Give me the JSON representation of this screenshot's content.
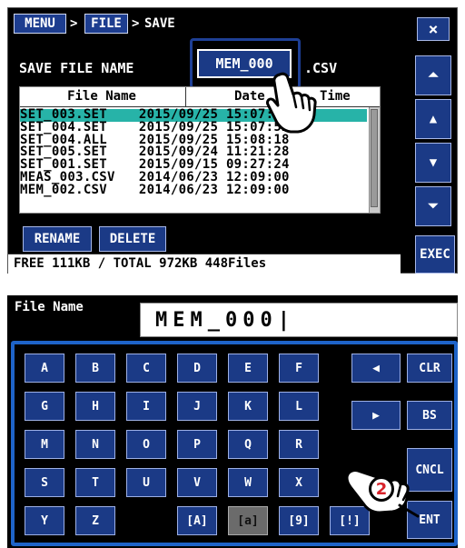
{
  "breadcrumb": {
    "menu": "MENU",
    "sep1": ">",
    "file": "FILE",
    "sep2": ">",
    "current": "SAVE"
  },
  "close_label": "×",
  "save": {
    "label": "SAVE FILE NAME",
    "filename": "MEM_000",
    "extension": ".CSV"
  },
  "table": {
    "headers": {
      "name": "File Name",
      "date": "Date",
      "time": "Time"
    },
    "rows": [
      {
        "text": "SET_003.SET    2015/09/25 15:07:36",
        "selected": true
      },
      {
        "text": "SET_004.SET    2015/09/25 15:07:52",
        "selected": false
      },
      {
        "text": "SET_004.ALL    2015/09/25 15:08:18",
        "selected": false
      },
      {
        "text": "SET_005.SET    2015/09/24 11:21:28",
        "selected": false
      },
      {
        "text": "SET_001.SET    2015/09/15 09:27:24",
        "selected": false
      },
      {
        "text": "MEAS_003.CSV   2014/06/23 12:09:00",
        "selected": false
      },
      {
        "text": "MEM_002.CSV    2014/06/23 12:09:00",
        "selected": false
      }
    ]
  },
  "actions": {
    "rename": "RENAME",
    "delete": "DELETE"
  },
  "status": "FREE 111KB / TOTAL 972KB 448Files",
  "side": {
    "first": "⏶",
    "up": "▲",
    "down": "▼",
    "last": "⏷",
    "exec": "EXEC"
  },
  "keyboard": {
    "title": "File Name",
    "value": "MEM_000|",
    "rows": [
      [
        "A",
        "B",
        "C",
        "D",
        "E",
        "F"
      ],
      [
        "G",
        "H",
        "I",
        "J",
        "K",
        "L"
      ],
      [
        "M",
        "N",
        "O",
        "P",
        "Q",
        "R"
      ],
      [
        "S",
        "T",
        "U",
        "V",
        "W",
        "X"
      ],
      [
        "Y",
        "Z",
        "",
        "[A]",
        "[a]",
        "[9]"
      ]
    ],
    "mode_special": "[!]",
    "left": "◀",
    "right": "▶",
    "clr": "CLR",
    "bs": "BS",
    "cncl": "CNCL",
    "ent": "ENT"
  },
  "callout": "2",
  "colors": {
    "key_blue": "#1b3a86",
    "highlight_teal": "#27b3a8",
    "frame_blue": "#1e63c8"
  }
}
